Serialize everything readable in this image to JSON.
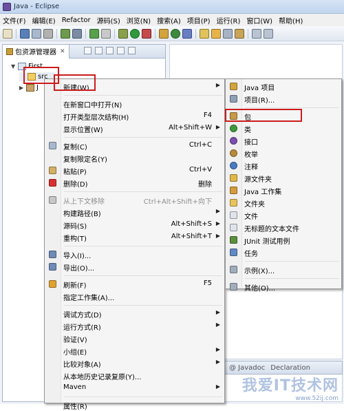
{
  "window": {
    "title": "Java - Eclipse"
  },
  "menubar": [
    "文件(F)",
    "编辑(E)",
    "Refactor",
    "源码(S)",
    "浏览(N)",
    "搜索(A)",
    "项目(P)",
    "运行(R)",
    "窗口(W)",
    "帮助(H)"
  ],
  "view": {
    "tab_label": "包资源管理器",
    "close_glyph": "✕",
    "tree": {
      "project": "First",
      "src": "src",
      "jre": "J"
    }
  },
  "context_menu": {
    "items": [
      {
        "label": "新建(W)",
        "submenu": true,
        "icon": "none"
      },
      {
        "sep": true
      },
      {
        "label": "在新窗口中打开(N)",
        "icon": "none"
      },
      {
        "label": "打开类型层次结构(H)",
        "shortcut": "F4",
        "icon": "none"
      },
      {
        "label": "显示位置(W)",
        "shortcut": "Alt+Shift+W",
        "submenu": true,
        "icon": "none"
      },
      {
        "sep": true
      },
      {
        "label": "复制(C)",
        "shortcut": "Ctrl+C",
        "icon": "copy-icon"
      },
      {
        "label": "复制限定名(Y)",
        "icon": "none"
      },
      {
        "label": "粘贴(P)",
        "shortcut": "Ctrl+V",
        "icon": "paste-icon"
      },
      {
        "label": "删除(D)",
        "shortcut": "删除",
        "icon": "delete-icon"
      },
      {
        "sep": true
      },
      {
        "label": "从上下文移除",
        "shortcut": "Ctrl+Alt+Shift+向下",
        "icon": "remove-context-icon",
        "disabled": true
      },
      {
        "label": "构建路径(B)",
        "submenu": true,
        "icon": "none"
      },
      {
        "label": "源码(S)",
        "shortcut": "Alt+Shift+S",
        "submenu": true,
        "icon": "none"
      },
      {
        "label": "重构(T)",
        "shortcut": "Alt+Shift+T",
        "submenu": true,
        "icon": "none"
      },
      {
        "sep": true
      },
      {
        "label": "导入(I)...",
        "icon": "import-icon"
      },
      {
        "label": "导出(O)...",
        "icon": "export-icon"
      },
      {
        "sep": true
      },
      {
        "label": "刷新(F)",
        "shortcut": "F5",
        "icon": "refresh-icon"
      },
      {
        "label": "指定工作集(A)...",
        "icon": "none"
      },
      {
        "sep": true
      },
      {
        "label": "调试方式(D)",
        "submenu": true,
        "icon": "none"
      },
      {
        "label": "运行方式(R)",
        "submenu": true,
        "icon": "none"
      },
      {
        "label": "验证(V)",
        "icon": "none"
      },
      {
        "label": "小组(E)",
        "submenu": true,
        "icon": "none"
      },
      {
        "label": "比较对象(A)",
        "submenu": true,
        "icon": "none"
      },
      {
        "label": "从本地历史记录复原(Y)...",
        "icon": "none"
      },
      {
        "label": "Maven",
        "submenu": true,
        "icon": "none"
      },
      {
        "sep": true
      },
      {
        "label": "属性(R)",
        "icon": "none"
      }
    ]
  },
  "submenu": {
    "items": [
      {
        "label": "Java 项目",
        "icon": "java-project-icon"
      },
      {
        "label": "项目(R)...",
        "icon": "project-icon"
      },
      {
        "sep": true
      },
      {
        "label": "包",
        "icon": "package-icon"
      },
      {
        "label": "类",
        "icon": "class-icon"
      },
      {
        "label": "接口",
        "icon": "interface-icon"
      },
      {
        "label": "枚举",
        "icon": "enum-icon"
      },
      {
        "label": "注释",
        "icon": "annotation-icon"
      },
      {
        "label": "源文件夹",
        "icon": "source-folder-icon"
      },
      {
        "label": "Java 工作集",
        "icon": "java-working-set-icon"
      },
      {
        "label": "文件夹",
        "icon": "folder-icon"
      },
      {
        "label": "文件",
        "icon": "file-icon"
      },
      {
        "label": "无标题的文本文件",
        "icon": "untitled-text-file-icon"
      },
      {
        "label": "JUnit 测试用例",
        "icon": "junit-test-icon"
      },
      {
        "label": "任务",
        "icon": "task-icon"
      },
      {
        "sep": true
      },
      {
        "label": "示例(X)...",
        "icon": "example-icon"
      },
      {
        "sep": true
      },
      {
        "label": "其他(O)...",
        "icon": "other-icon"
      }
    ]
  },
  "bottom_tabs": [
    "@ Javadoc",
    "Declaration"
  ],
  "watermark": {
    "text": "我爱IT技术网",
    "url": "www.52ij.com"
  },
  "colors": {
    "highlight": "#cc1b1b",
    "menu_bg": "#f5f5f5"
  }
}
